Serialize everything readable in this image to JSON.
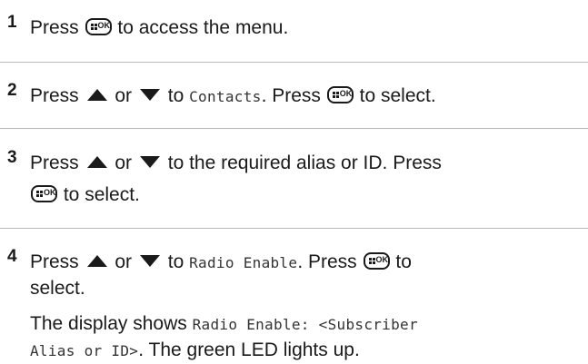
{
  "steps": [
    {
      "number": "1",
      "t1": "Press",
      "t2": "to access the menu."
    },
    {
      "number": "2",
      "t1": "Press",
      "or": "or",
      "t2": "to",
      "code": "Contacts",
      "t3": ". Press",
      "t4": "to select."
    },
    {
      "number": "3",
      "t1": "Press",
      "or": "or",
      "t2": "to the required alias or ID. Press",
      "t3": "to select."
    },
    {
      "number": "4",
      "t1": "Press",
      "or": "or",
      "t2": "to",
      "code": "Radio Enable",
      "t3": ". Press",
      "t4": "to",
      "t5": "select.",
      "d1": "The display shows",
      "code2": "Radio Enable: <Subscriber",
      "code3": "Alias or ID>",
      "d2": ". The green LED lights up."
    }
  ],
  "key_label": "OK"
}
